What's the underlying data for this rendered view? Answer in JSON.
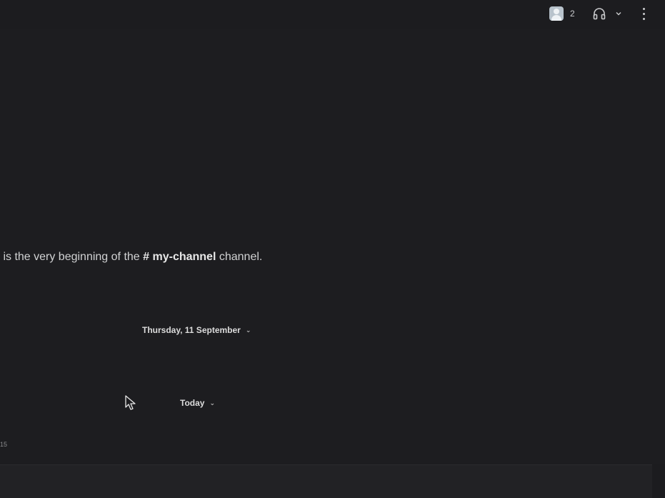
{
  "header": {
    "member_count": "2",
    "icons": {
      "members": "avatar-icon",
      "huddle": "headphones-icon",
      "huddle_menu": "chevron-down-icon",
      "more": "kebab-menu-icon"
    }
  },
  "channel": {
    "intro_prefix": "s is the very beginning of the ",
    "hash": "#",
    "name": "my-channel",
    "intro_suffix": " channel."
  },
  "dividers": [
    {
      "label": "Thursday, 11 September",
      "chevron": "⌄"
    },
    {
      "label": "Today",
      "chevron": "⌄"
    }
  ],
  "partial_text": "15",
  "colors": {
    "background": "#1d1d20",
    "text": "#d1d2d3"
  }
}
